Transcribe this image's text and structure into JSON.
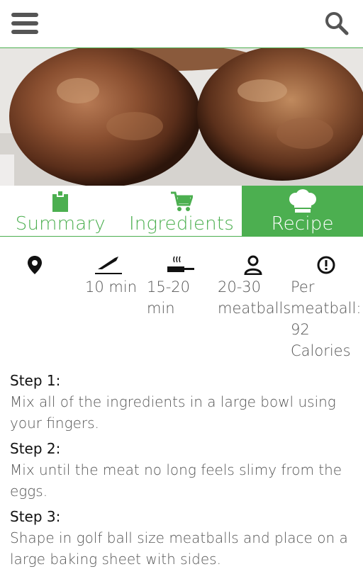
{
  "header": {
    "menu_icon": "menu-icon",
    "search_icon": "search-icon"
  },
  "tabs": [
    {
      "label": "Summary",
      "icon": "clipboard-icon",
      "active": false
    },
    {
      "label": "Ingredients",
      "icon": "cart-icon",
      "active": false
    },
    {
      "label": "Recipe",
      "icon": "chef-hat-icon",
      "active": true
    }
  ],
  "info": {
    "location_icon": "location-pin-icon",
    "prep_icon": "knife-icon",
    "prep_time": "10 min",
    "cook_icon": "frying-pan-icon",
    "cook_time": "15-20 min",
    "servings_icon": "person-icon",
    "servings": "20-30 meatballs",
    "nutrition_icon": "alert-circle-icon",
    "calories": "Per meatball: 92 Calories"
  },
  "steps": [
    {
      "title": "Step 1:",
      "text": "Mix all of the ingredients in a large bowl using your fingers."
    },
    {
      "title": "Step 2:",
      "text": "Mix until the meat no long feels slimy from the eggs."
    },
    {
      "title": "Step 3:",
      "text": "Shape in golf ball size meatballs and place on a large baking sheet with sides."
    }
  ],
  "colors": {
    "accent": "#4caf50",
    "text": "#555555"
  }
}
